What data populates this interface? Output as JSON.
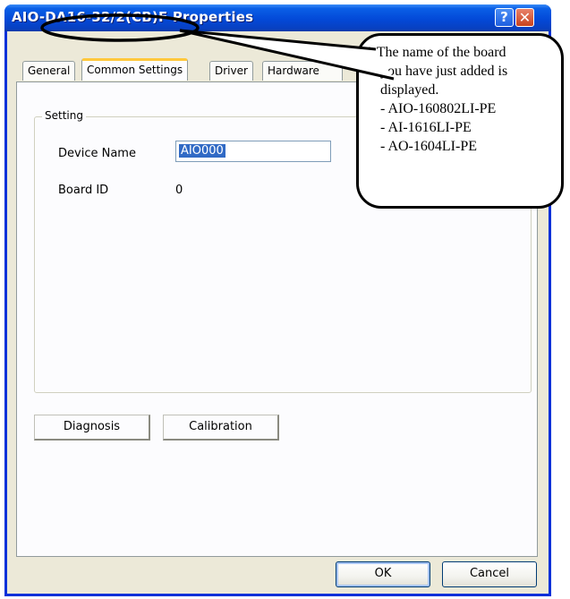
{
  "window": {
    "title": "AIO-DA16-32/2(CB)F Properties",
    "help_glyph": "?",
    "close_glyph": "✕"
  },
  "tabs": [
    {
      "label": "General",
      "active": false
    },
    {
      "label": "Common Settings",
      "active": true
    },
    {
      "label": "Driver",
      "active": false
    },
    {
      "label": "Hardware",
      "active": false
    }
  ],
  "setting": {
    "legend": "Setting",
    "device_name_label": "Device Name",
    "device_name_value": "AIO000",
    "board_id_label": "Board ID",
    "board_id_value": "0"
  },
  "buttons": {
    "diagnosis": "Diagnosis",
    "calibration": "Calibration",
    "ok": "OK",
    "cancel": "Cancel"
  },
  "callout": {
    "lines": [
      "* The name of the board",
      "you have just added is",
      "displayed.",
      "- AIO-160802LI-PE",
      "- AI-1616LI-PE",
      "- AO-1604LI-PE"
    ]
  },
  "colors": {
    "titlebar": "#0349d8",
    "dialog_bg": "#ece9d8",
    "selection": "#316ac5",
    "tab_highlight": "#ffc83c"
  }
}
